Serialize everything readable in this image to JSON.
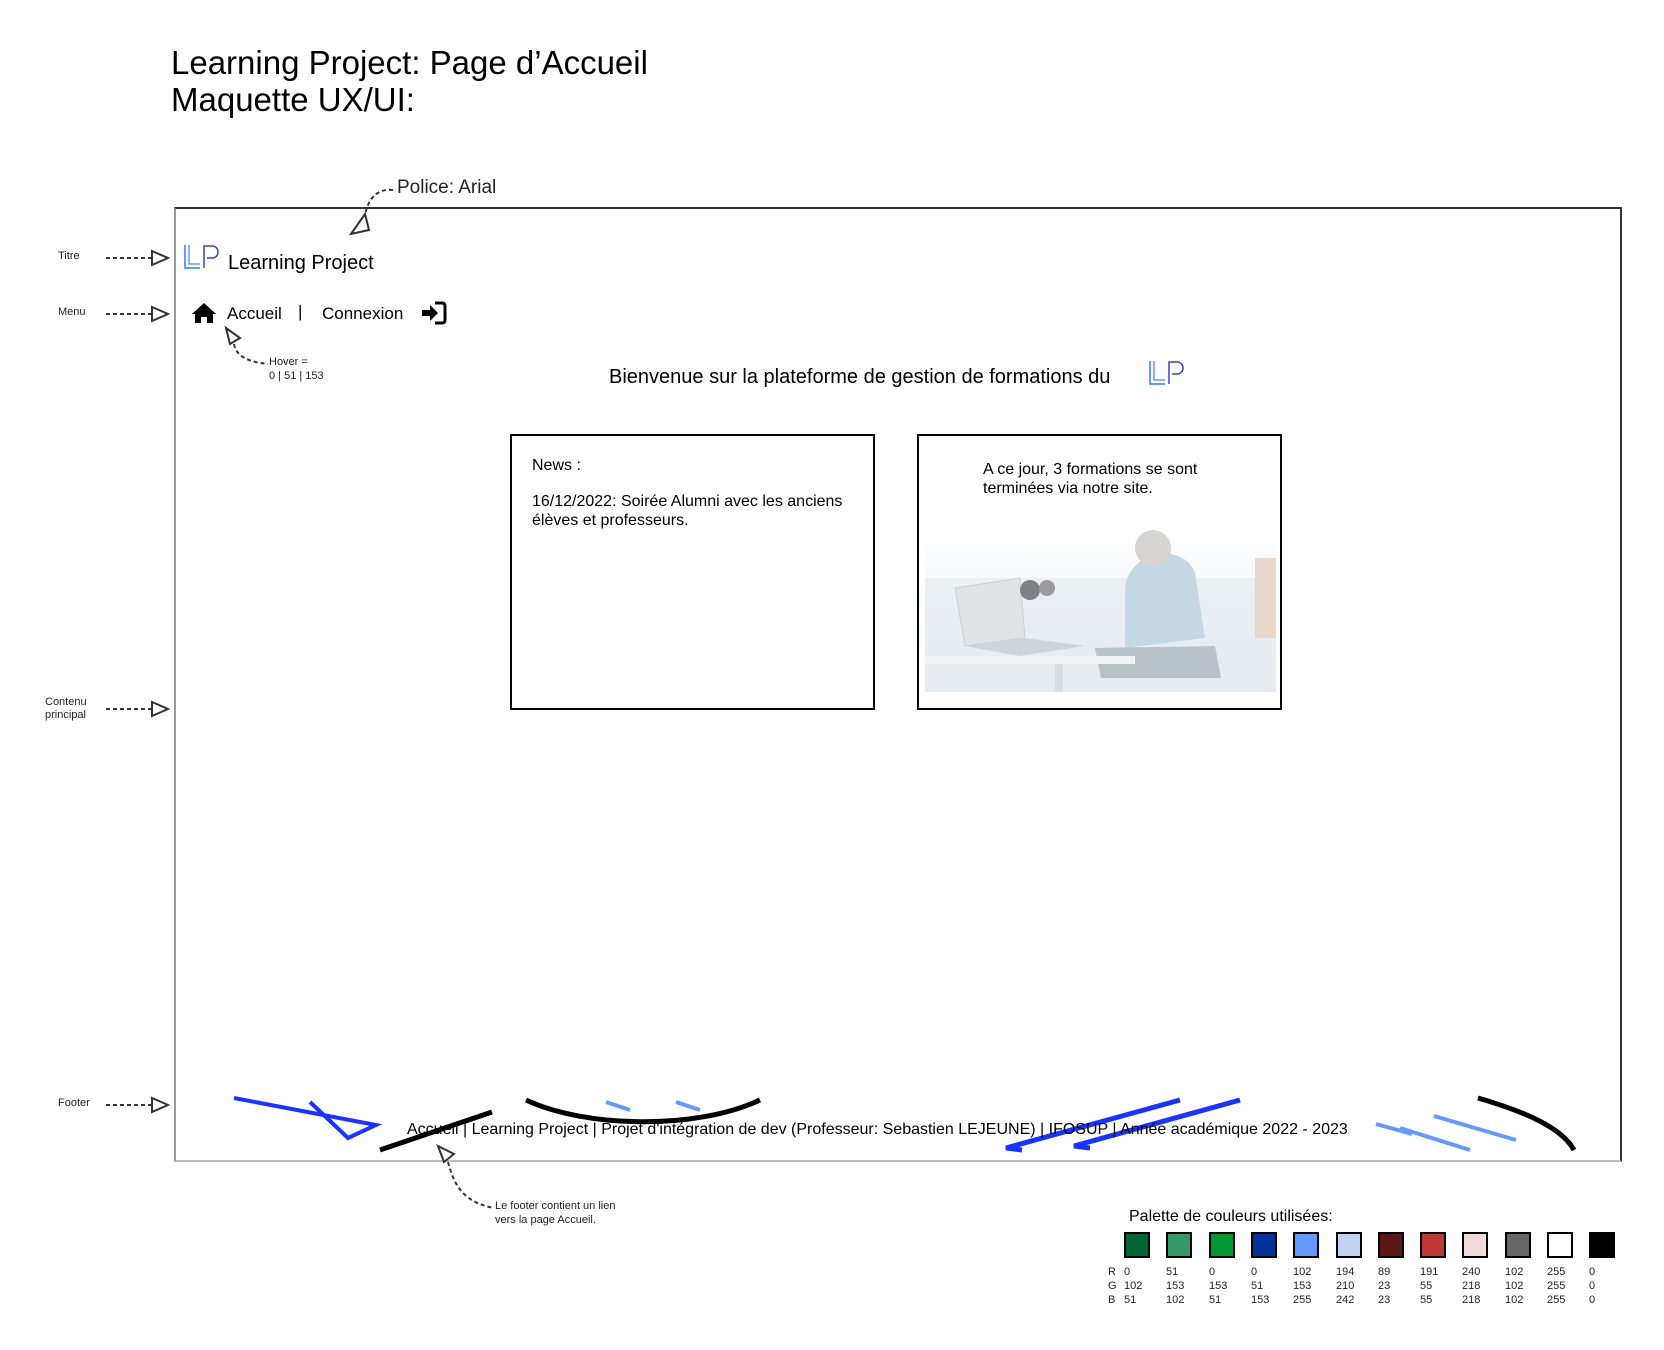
{
  "document": {
    "title_line1": "Learning Project: Page d’Accueil",
    "title_line2": "Maquette UX/UI:"
  },
  "annotations": {
    "font_note": "Police: Arial",
    "hover_line1": "Hover =",
    "hover_line2": "0 | 51 | 153",
    "footer_note_line1": "Le footer contient un lien",
    "footer_note_line2": "vers la page Accueil."
  },
  "side_labels": {
    "titre": "Titre",
    "menu": "Menu",
    "contenu_line1": "Contenu",
    "contenu_line2": "principal",
    "footer": "Footer"
  },
  "site": {
    "logo_text": "LP",
    "title": "Learning Project",
    "menu": {
      "home": "Accueil",
      "separator": "|",
      "login": "Connexion"
    },
    "welcome": "Bienvenue sur la plateforme de gestion de formations du",
    "news_card": {
      "heading": "News :",
      "body": "16/12/2022: Soirée Alumni avec les anciens élèves et professeurs."
    },
    "stats_card": {
      "body": "A ce jour, 3 formations se sont terminées via notre site."
    },
    "footer": {
      "link": "Accueil",
      "rest": " | Learning Project | Projet d'intégration de dev (Professeur: Sebastien LEJEUNE) | IFOSUP | Année académique 2022 - 2023"
    }
  },
  "palette": {
    "title": "Palette de couleurs utilisées:",
    "row_labels": [
      "R",
      "G",
      "B"
    ],
    "colors": [
      {
        "hex": "#006633",
        "r": "0",
        "g": "102",
        "b": "51"
      },
      {
        "hex": "#339966",
        "r": "51",
        "g": "153",
        "b": "102"
      },
      {
        "hex": "#009933",
        "r": "0",
        "g": "153",
        "b": "51"
      },
      {
        "hex": "#003399",
        "r": "0",
        "g": "51",
        "b": "153"
      },
      {
        "hex": "#6699FF",
        "r": "102",
        "g": "153",
        "b": "255"
      },
      {
        "hex": "#C2D2F2",
        "r": "194",
        "g": "210",
        "b": "242"
      },
      {
        "hex": "#591717",
        "r": "89",
        "g": "23",
        "b": "23"
      },
      {
        "hex": "#BF3737",
        "r": "191",
        "g": "55",
        "b": "55"
      },
      {
        "hex": "#F0DADA",
        "r": "240",
        "g": "218",
        "b": "218"
      },
      {
        "hex": "#666666",
        "r": "102",
        "g": "102",
        "b": "102"
      },
      {
        "hex": "#FFFFFF",
        "r": "255",
        "g": "255",
        "b": "255"
      },
      {
        "hex": "#000000",
        "r": "0",
        "g": "0",
        "b": "0"
      }
    ]
  }
}
